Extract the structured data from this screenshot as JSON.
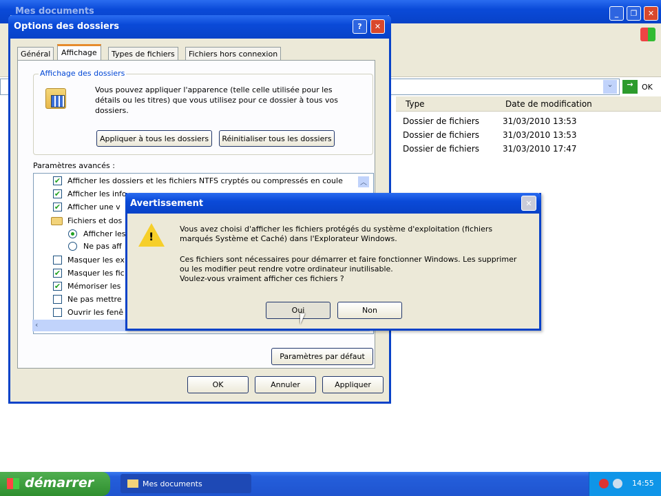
{
  "explorer": {
    "title": "Mes documents",
    "go_label": "OK",
    "columns": [
      "Type",
      "Date de modification"
    ],
    "rows": [
      {
        "type": "Dossier de fichiers",
        "date": "31/03/2010 13:53"
      },
      {
        "type": "Dossier de fichiers",
        "date": "31/03/2010 13:53"
      },
      {
        "type": "Dossier de fichiers",
        "date": "31/03/2010 17:47"
      }
    ]
  },
  "options": {
    "title": "Options des dossiers",
    "help": "?",
    "tabs": [
      "Général",
      "Affichage",
      "Types de fichiers",
      "Fichiers hors connexion"
    ],
    "group_title": "Affichage des dossiers",
    "group_text": "Vous pouvez appliquer l'apparence (telle celle utilisée pour les détails ou les titres) que vous utilisez pour ce dossier à tous vos dossiers.",
    "apply_all": "Appliquer à tous les dossiers",
    "reset_all": "Réinitialiser tous les dossiers",
    "advanced_label": "Paramètres avancés :",
    "advanced": [
      {
        "kind": "check",
        "checked": true,
        "label": "Afficher les dossiers et les fichiers NTFS cryptés ou compressés en coule"
      },
      {
        "kind": "check",
        "checked": true,
        "label": "Afficher les info"
      },
      {
        "kind": "check",
        "checked": true,
        "label": "Afficher une v"
      },
      {
        "kind": "folder",
        "label": "Fichiers et dos"
      },
      {
        "kind": "radio",
        "checked": true,
        "label": "Afficher les"
      },
      {
        "kind": "radio",
        "checked": false,
        "label": "Ne pas aff"
      },
      {
        "kind": "check",
        "checked": false,
        "label": "Masquer les ex"
      },
      {
        "kind": "check",
        "checked": true,
        "label": "Masquer les fic"
      },
      {
        "kind": "check",
        "checked": true,
        "label": "Mémoriser les"
      },
      {
        "kind": "check",
        "checked": false,
        "label": "Ne pas mettre"
      },
      {
        "kind": "check",
        "checked": false,
        "label": "Ouvrir les fenê"
      }
    ],
    "defaults": "Paramètres par défaut",
    "ok": "OK",
    "cancel": "Annuler",
    "apply": "Appliquer"
  },
  "warning": {
    "title": "Avertissement",
    "line1": "Vous avez choisi d'afficher les fichiers protégés du système d'exploitation (fichiers",
    "line2": "marqués Système et Caché) dans l'Explorateur Windows.",
    "line3": "Ces fichiers sont nécessaires pour démarrer et faire fonctionner Windows. Les supprimer",
    "line4": "ou les modifier peut rendre votre ordinateur inutilisable.",
    "line5": "Voulez-vous vraiment afficher ces fichiers ?",
    "yes": "Oui",
    "no": "Non"
  },
  "taskbar": {
    "start": "démarrer",
    "task": "Mes documents",
    "clock": "14:55"
  }
}
